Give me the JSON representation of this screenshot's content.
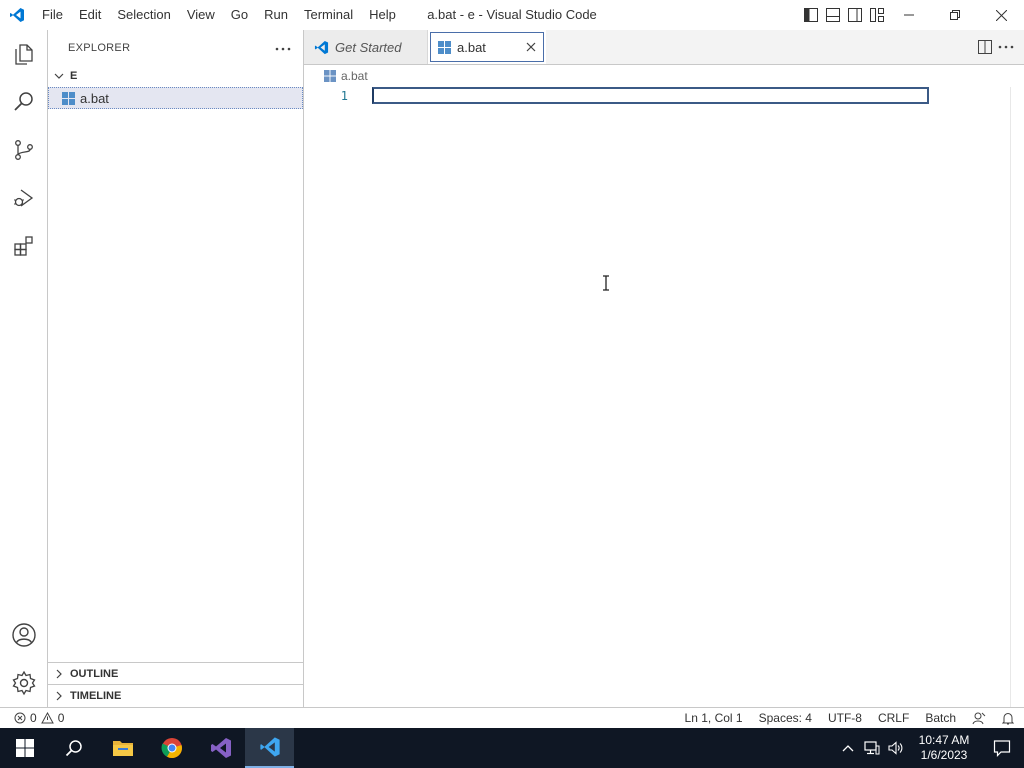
{
  "window": {
    "title": "a.bat - e - Visual Studio Code",
    "menu": [
      "File",
      "Edit",
      "Selection",
      "View",
      "Go",
      "Run",
      "Terminal",
      "Help"
    ]
  },
  "activity_bar": {
    "items": [
      "explorer-icon",
      "search-icon",
      "source-control-icon",
      "run-debug-icon",
      "extensions-icon"
    ],
    "bottom": [
      "account-icon",
      "manage-gear-icon"
    ]
  },
  "sidebar": {
    "header": "EXPLORER",
    "folder": "E",
    "files": [
      {
        "name": "a.bat",
        "selected": true
      }
    ],
    "sections": [
      "OUTLINE",
      "TIMELINE"
    ]
  },
  "editor": {
    "tabs": [
      {
        "label": "Get Started",
        "active": false
      },
      {
        "label": "a.bat",
        "active": true
      }
    ],
    "breadcrumb": "a.bat",
    "lines": [
      {
        "number": "1",
        "text": ""
      }
    ]
  },
  "status_bar": {
    "errors": "0",
    "warnings": "0",
    "position": "Ln 1, Col 1",
    "spaces": "Spaces: 4",
    "encoding": "UTF-8",
    "eol": "CRLF",
    "language": "Batch"
  },
  "taskbar": {
    "apps": [
      "start-icon",
      "search-icon",
      "file-explorer-icon",
      "chrome-icon",
      "visual-studio-icon",
      "vscode-icon"
    ],
    "time": "10:47 AM",
    "date": "1/6/2023"
  },
  "colors": {
    "vscode_blue": "#0078d4",
    "taskbar_bg": "#0f1724",
    "selection_bg": "#e4e6f1",
    "line_number": "#237893"
  }
}
